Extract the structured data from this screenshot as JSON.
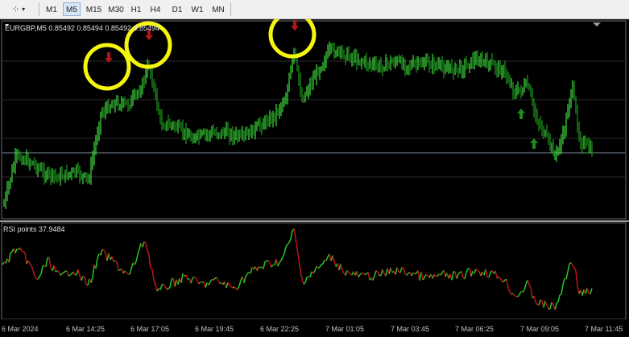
{
  "toolbar": {
    "tools": [
      {
        "name": "line-tools-icon",
        "glyph": "⁘"
      },
      {
        "name": "dropdown-icon",
        "glyph": "▾"
      }
    ],
    "timeframes": [
      "M1",
      "M5",
      "M15",
      "M30",
      "H1",
      "H4",
      "D1",
      "W1",
      "MN"
    ],
    "active_timeframe": "M5"
  },
  "main_chart": {
    "title": "EURGBP,M5  0.85492 0.85494 0.85492 0.85494",
    "up_color": "#22c922",
    "down_color": "#c0141e",
    "highlight_color": "#f5f50f"
  },
  "rsi_chart": {
    "title": "RSI points 37.9484",
    "up_color": "#22c922",
    "down_color": "#c0141e"
  },
  "x_axis": {
    "labels": [
      "6 Mar 2024",
      "6 Mar 14:25",
      "6 Mar 17:05",
      "6 Mar 19:45",
      "6 Mar 22:25",
      "7 Mar 01:05",
      "7 Mar 03:45",
      "7 Mar 06:25",
      "7 Mar 09:05",
      "7 Mar 11:45"
    ]
  },
  "signals": {
    "sell": [
      {
        "name": "sell-arrow-icon-1"
      },
      {
        "name": "sell-arrow-icon-2"
      },
      {
        "name": "sell-arrow-icon-3"
      }
    ],
    "buy": [
      {
        "name": "buy-arrow-icon-1"
      },
      {
        "name": "buy-arrow-icon-2"
      }
    ]
  }
}
